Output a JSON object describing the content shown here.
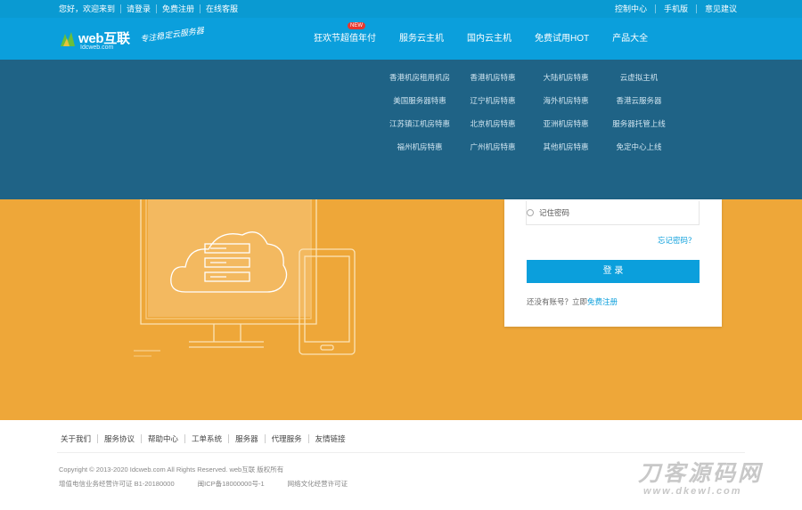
{
  "topbar": {
    "left_links": [
      "您好，欢迎来到",
      "请登录",
      "免费注册",
      "在线客服"
    ],
    "right_links": [
      "控制中心",
      "手机版",
      "意见建议"
    ]
  },
  "header": {
    "logo_brand": "web互联",
    "logo_domain": "Idcweb.com",
    "slogan": "专注稳定云服务器"
  },
  "nav": {
    "items": [
      {
        "label": "狂欢节超值年付",
        "badge": "NEW"
      },
      {
        "label": "服务云主机"
      },
      {
        "label": "国内云主机"
      },
      {
        "label": "免费试用HOT"
      },
      {
        "label": "产品大全"
      }
    ]
  },
  "dropdown": {
    "items": [
      "香港机房租用机房",
      "香港机房特惠",
      "大陆机房特惠",
      "云虚拟主机",
      "美国服务器特惠",
      "辽宁机房特惠",
      "海外机房特惠",
      "香港云服务器",
      "江苏镇江机房特惠",
      "北京机房特惠",
      "亚洲机房特惠",
      "服务器托管上线",
      "福州机房特惠",
      "广州机房特惠",
      "其他机房特惠",
      "免定中心上线"
    ]
  },
  "login": {
    "remember_label": "记住密码",
    "forgot_label": "忘记密码？",
    "submit_label": "登 录",
    "register_prompt": "还没有账号？立即",
    "register_link": "免费注册"
  },
  "footer": {
    "links": [
      "关于我们",
      "服务协议",
      "帮助中心",
      "工单系统",
      "服务器",
      "代理服务",
      "友情链接"
    ],
    "copyright": "Copyright © 2013-2020 Idcweb.com All Rights Reserved. web互联 版权所有",
    "icp": [
      "增值电信业务经营许可证 B1-20180000",
      "闽ICP备18000000号-1",
      "网络文化经营许可证"
    ]
  },
  "watermark": {
    "big": "刀客源码网",
    "small": "www.dkewl.com"
  },
  "colors": {
    "primary": "#0b9fdc",
    "dropdown_bg": "#1f6386",
    "hero_bg": "#eea739"
  }
}
